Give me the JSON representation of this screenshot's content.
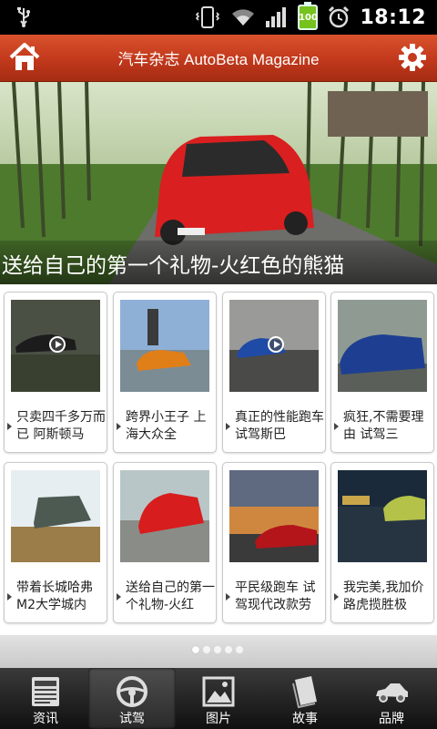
{
  "status_bar": {
    "time": "18:12",
    "battery_level": "100",
    "icons": [
      "usb-icon",
      "vibrate-icon",
      "wifi-icon",
      "signal-icon",
      "battery-icon",
      "alarm-icon"
    ]
  },
  "header": {
    "title": "汽车杂志 AutoBeta Magazine",
    "color": "#c43a1d"
  },
  "hero": {
    "caption": "送给自己的第一个礼物-火红色的熊猫"
  },
  "cards": [
    {
      "caption": "只卖四千多万而已 阿斯顿马",
      "video": true
    },
    {
      "caption": "跨界小王子 上海大众全",
      "video": false
    },
    {
      "caption": "真正的性能跑车 试驾斯巴",
      "video": true
    },
    {
      "caption": "疯狂,不需要理由 试驾三",
      "video": false
    },
    {
      "caption": "带着长城哈弗M2大学城内",
      "video": false
    },
    {
      "caption": "送给自己的第一个礼物-火红",
      "video": false
    },
    {
      "caption": "平民级跑车 试驾现代改款劳",
      "video": false
    },
    {
      "caption": "我完美,我加价 路虎揽胜极",
      "video": false
    }
  ],
  "pager": {
    "pages": 5,
    "current": 1
  },
  "tabs": [
    {
      "label": "资讯",
      "icon": "news-icon",
      "active": false
    },
    {
      "label": "试驾",
      "icon": "steering-wheel-icon",
      "active": true
    },
    {
      "label": "图片",
      "icon": "picture-icon",
      "active": false
    },
    {
      "label": "故事",
      "icon": "book-icon",
      "active": false
    },
    {
      "label": "品牌",
      "icon": "car-icon",
      "active": false
    }
  ]
}
